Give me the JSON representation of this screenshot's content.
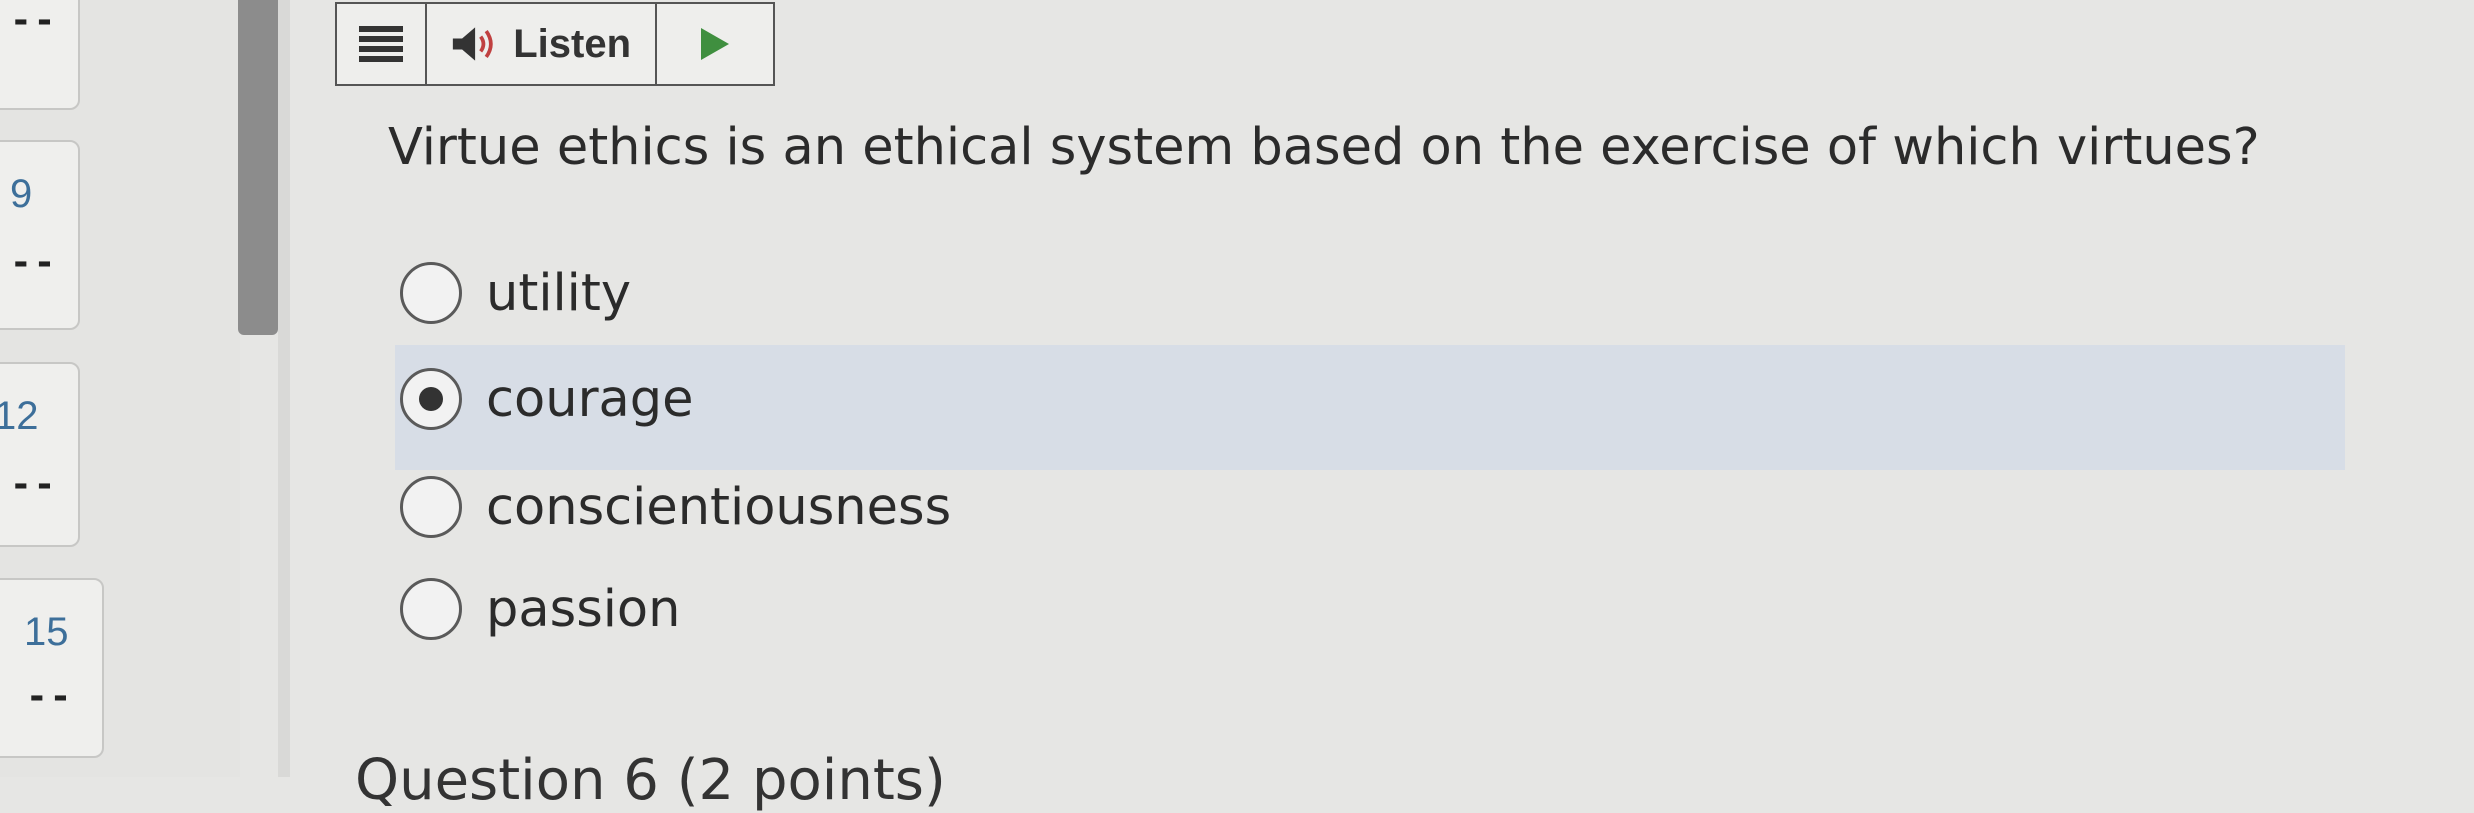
{
  "nav": {
    "items": [
      {
        "number": "",
        "answer": "--"
      },
      {
        "number": "9",
        "answer": "--"
      },
      {
        "number": "12",
        "answer": "--"
      },
      {
        "number": "15",
        "answer": "--"
      }
    ]
  },
  "toolbar": {
    "listen_label": "Listen",
    "menu_icon": "menu-icon",
    "speaker_icon": "speaker-icon",
    "play_icon": "play-icon",
    "play_color": "#3f8f3f"
  },
  "question": {
    "text": "Virtue ethics is an ethical system based on the exercise of which virtues?",
    "options": [
      {
        "label": "utility",
        "selected": false
      },
      {
        "label": "courage",
        "selected": true
      },
      {
        "label": "conscientiousness",
        "selected": false
      },
      {
        "label": "passion",
        "selected": false
      }
    ]
  },
  "next_question": {
    "title": "Question 6 (2 points)"
  },
  "colors": {
    "highlight": "#d7dde6",
    "nav_number": "#3d6f9a"
  }
}
